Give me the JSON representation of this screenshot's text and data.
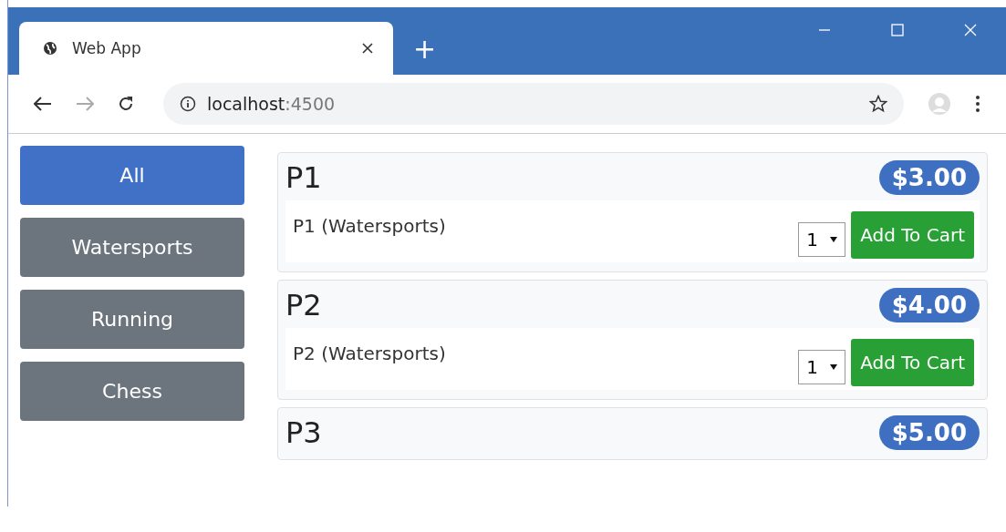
{
  "browser": {
    "tab_title": "Web App",
    "new_tab": "+",
    "address": {
      "host": "localhost",
      "port": ":4500"
    }
  },
  "categories": [
    {
      "label": "All",
      "selected": true
    },
    {
      "label": "Watersports",
      "selected": false
    },
    {
      "label": "Running",
      "selected": false
    },
    {
      "label": "Chess",
      "selected": false
    }
  ],
  "products": [
    {
      "name": "P1",
      "price": "$3.00",
      "description": "P1 (Watersports)",
      "quantity": "1",
      "button": "Add To Cart"
    },
    {
      "name": "P2",
      "price": "$4.00",
      "description": "P2 (Watersports)",
      "quantity": "1",
      "button": "Add To Cart"
    },
    {
      "name": "P3",
      "price": "$5.00"
    }
  ]
}
